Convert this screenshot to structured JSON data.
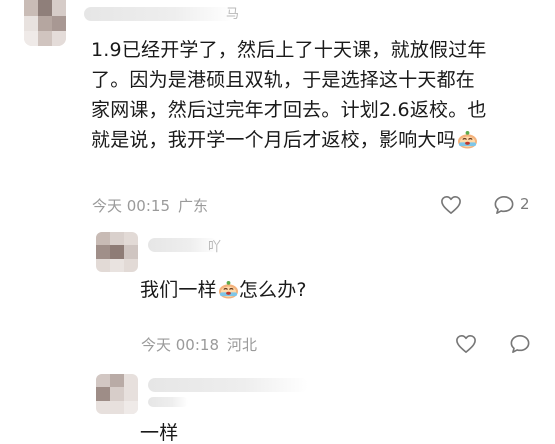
{
  "comment_main": {
    "name_tail": "马",
    "text_lines": [
      "1.9已经开学了，然后上了十天课，就放假过年",
      "了。因为是港硕且双轨，于是选择这十天都在",
      "家网课，然后过完年才回去。计划2.6返校。也",
      "就是说，我开学一个月后才返校，影响大吗"
    ],
    "emoji": "crying-face-emoji",
    "time": "今天 00:15",
    "location": "广东",
    "reply_count": "2",
    "icons": {
      "like": "heart-outline-icon",
      "reply": "speech-bubble-icon"
    }
  },
  "reply_1": {
    "name_tail": "吖",
    "text_before": "我们一样",
    "emoji": "crying-face-emoji",
    "text_after": "怎么办?",
    "time": "今天 00:18",
    "location": "河北",
    "icons": {
      "like": "heart-outline-icon",
      "reply": "speech-bubble-icon"
    }
  },
  "reply_2": {
    "text": "一样"
  },
  "colors": {
    "text": "#1a1a1a",
    "meta": "#9a9a9a",
    "icon": "#777777"
  }
}
